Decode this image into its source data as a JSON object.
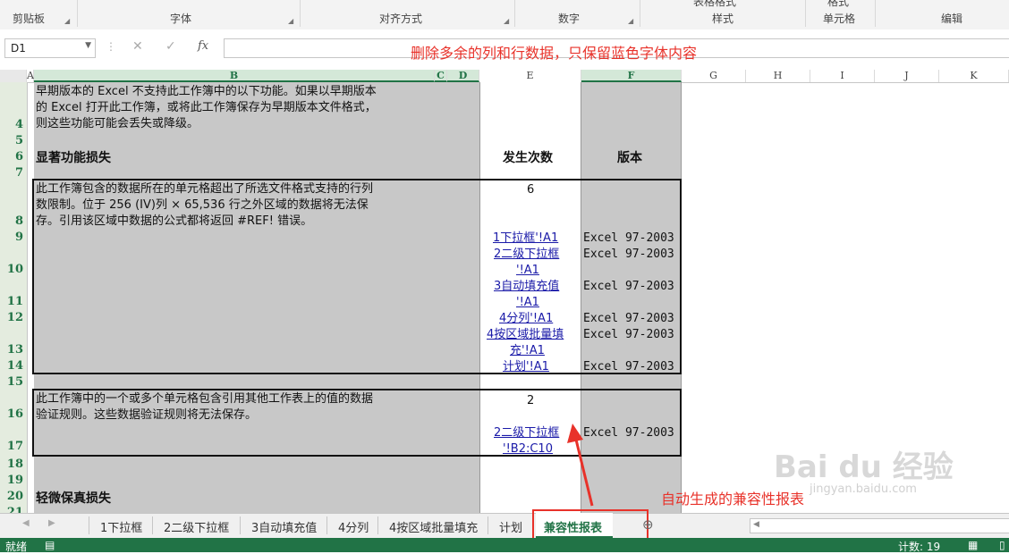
{
  "ribbon": {
    "groups": [
      "剪贴板",
      "字体",
      "对齐方式",
      "数字",
      "样式",
      "单元格",
      "编辑"
    ],
    "top_fragments": [
      "表格格式",
      "格式"
    ]
  },
  "formula_bar": {
    "name_box": "D1",
    "cancel_symbol": "✕",
    "enter_symbol": "✓",
    "fx_symbol": "fx",
    "value": ""
  },
  "annotations": {
    "top": "删除多余的列和行数据，只保留蓝色字体内容",
    "bottom": "自动生成的兼容性报表"
  },
  "columns": [
    "A",
    "B",
    "C",
    "D",
    "E",
    "F",
    "G",
    "H",
    "I",
    "J",
    "K"
  ],
  "rows": [
    "4",
    "5",
    "6",
    "7",
    "8",
    "9",
    "10",
    "11",
    "12",
    "13",
    "14",
    "15",
    "16",
    "17",
    "18",
    "19",
    "20",
    "21"
  ],
  "sheet": {
    "intro": [
      "早期版本的 Excel 不支持此工作簿中的以下功能。如果以早期版本",
      "的 Excel 打开此工作簿，或将此工作簿保存为早期版本文件格式，",
      "则这些功能可能会丢失或降级。"
    ],
    "major_loss": "显著功能损失",
    "col_count": "发生次数",
    "col_version": "版本",
    "issue1": [
      "此工作簿包含的数据所在的单元格超出了所选文件格式支持的行列",
      "数限制。位于 256 (IV)列 × 65,536 行之外区域的数据将无法保",
      "存。引用该区域中数据的公式都将返回 #REF! 错误。"
    ],
    "issue1_count": "6",
    "issue1_links": [
      "1下拉框'!A1",
      "2二级下拉框",
      "'!A1",
      "3自动填充值",
      "'!A1",
      "4分列'!A1",
      "4按区域批量填",
      "充'!A1",
      "计划'!A1"
    ],
    "issue1_versions": [
      "Excel 97-2003",
      "Excel 97-2003",
      "Excel 97-2003",
      "Excel 97-2003",
      "Excel 97-2003",
      "Excel 97-2003"
    ],
    "issue2": [
      "此工作簿中的一个或多个单元格包含引用其他工作表上的值的数据",
      "验证规则。这些数据验证规则将无法保存。"
    ],
    "issue2_count": "2",
    "issue2_links": [
      "2二级下拉框",
      "'!B2:C10"
    ],
    "issue2_version": "Excel 97-2003",
    "minor_loss": "轻微保真损失"
  },
  "tabs": [
    "1下拉框",
    "2二级下拉框",
    "3自动填充值",
    "4分列",
    "4按区域批量填充",
    "计划",
    "兼容性报表"
  ],
  "active_tab": "兼容性报表",
  "status": {
    "ready": "就绪",
    "count": "计数: 19"
  },
  "colors": {
    "accent": "#217346",
    "annotation": "#e8322a",
    "link": "#1a1aa8"
  }
}
